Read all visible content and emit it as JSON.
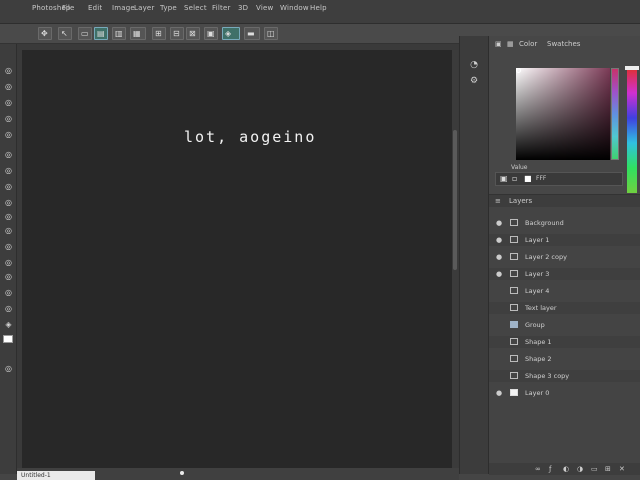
{
  "menu": {
    "items": [
      "Photoshop",
      "File",
      "Edit",
      "Image",
      "Layer",
      "Type",
      "Select",
      "Filter",
      "3D",
      "View",
      "Window",
      "Help"
    ]
  },
  "options_bar": {
    "tools": [
      "move-icon",
      "auto-select-icon",
      "transform-icon",
      "align-left-icon",
      "align-center-icon",
      "align-right-icon",
      "distribute-icon",
      "3d-icon",
      "arrange-icon"
    ]
  },
  "toolbar": {
    "tools": [
      "move-icon",
      "marquee-icon",
      "lasso-icon",
      "quick-select-icon",
      "crop-icon",
      "eyedropper-icon",
      "healing-icon",
      "brush-icon",
      "clone-icon",
      "history-icon",
      "eraser-icon",
      "gradient-icon",
      "blur-icon",
      "dodge-icon",
      "pen-icon",
      "type-icon",
      "path-select-icon",
      "shape-icon",
      "hand-icon",
      "zoom-icon"
    ],
    "foreground_color": "#ffffff",
    "background_color": "#3d3d3d"
  },
  "canvas": {
    "text": "lot, aogeino",
    "background": "#282828"
  },
  "status_bar": {
    "doc_tab": "Untitled-1"
  },
  "dock": {
    "buttons": [
      "history-icon",
      "properties-icon",
      "swatches-icon"
    ]
  },
  "color_panel": {
    "tabs": [
      "Color",
      "Swatches"
    ],
    "value_label": "Value",
    "hex": "FFF"
  },
  "layers_panel": {
    "title": "Layers",
    "layers": [
      {
        "name": "Background",
        "visible": true,
        "thumb": "dark"
      },
      {
        "name": "Layer 1",
        "visible": true,
        "thumb": "dark"
      },
      {
        "name": "Layer 2 copy",
        "visible": true,
        "thumb": "dark"
      },
      {
        "name": "Layer 3",
        "visible": true,
        "thumb": "dark"
      },
      {
        "name": "Layer 4",
        "visible": false,
        "thumb": "dark"
      },
      {
        "name": "Text layer",
        "visible": false,
        "thumb": "dark"
      },
      {
        "name": "Group",
        "visible": false,
        "thumb": "highlight"
      },
      {
        "name": "Shape 1",
        "visible": false,
        "thumb": "dark"
      },
      {
        "name": "Shape 2",
        "visible": false,
        "thumb": "dark"
      },
      {
        "name": "Shape 3 copy",
        "visible": false,
        "thumb": "dark"
      },
      {
        "name": "Layer 0",
        "visible": true,
        "thumb": "white"
      }
    ]
  }
}
